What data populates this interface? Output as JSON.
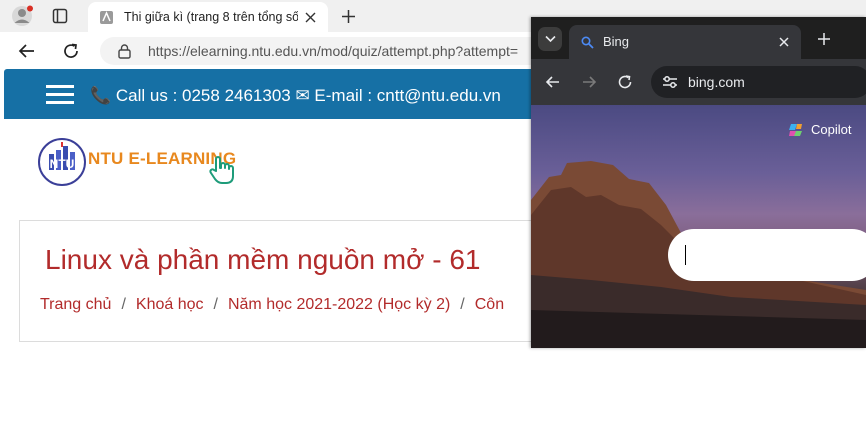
{
  "back_browser": {
    "tab_title": "Thi giữa kì (trang 8 trên tổng số 1",
    "url": "https://elearning.ntu.edu.vn/mod/quiz/attempt.php?attempt="
  },
  "site": {
    "contact": "📞 Call us : 0258 2461303 ✉ E-mail : cntt@ntu.edu.vn",
    "logo_text": "NTU E-LEARNING",
    "logo_badge": "NTU",
    "course_title": "Linux và phần mềm nguồn mở - 61",
    "breadcrumb": [
      "Trang chủ",
      "Khoá học",
      "Năm học 2021-2022 (Học kỳ 2)",
      "Côn"
    ]
  },
  "front_browser": {
    "tab_title": "Bing",
    "url": "bing.com",
    "copilot_label": "Copilot"
  },
  "colors": {
    "header_blue": "#1670a5",
    "title_red": "#b22b2b",
    "logo_orange": "#e8881e"
  },
  "icons": [
    "profile-icon",
    "tab-actions-icon",
    "favicon",
    "close-icon",
    "new-tab-icon",
    "back-icon",
    "reload-icon",
    "lock-icon",
    "hamburger-icon",
    "hand-pointer-icon",
    "tab-search-icon",
    "forward-icon",
    "site-info-icon",
    "bing-search-favicon",
    "copilot-icon"
  ]
}
